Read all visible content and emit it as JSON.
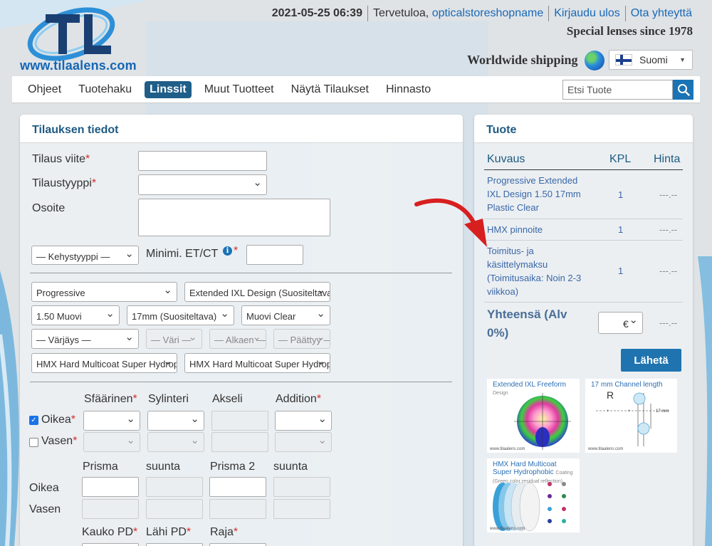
{
  "header": {
    "logo_text": "www.tilaalens.com",
    "datetime": "2021-05-25 06:39",
    "welcome_prefix": "Tervetuloa,",
    "username": "opticalstoreshopname",
    "logout": "Kirjaudu ulos",
    "contact": "Ota yhteyttä",
    "tagline": "Special lenses since 1978",
    "shipping": "Worldwide shipping",
    "language": "Suomi"
  },
  "nav": {
    "items": [
      "Ohjeet",
      "Tuotehaku",
      "Linssit",
      "Muut Tuotteet",
      "Näytä Tilaukset",
      "Hinnasto"
    ],
    "active_index": 2,
    "search_placeholder": "Etsi Tuote"
  },
  "order": {
    "title": "Tilauksen tiedot",
    "ref_label": "Tilaus viite",
    "type_label": "Tilaustyyppi",
    "address_label": "Osoite",
    "frame_type": "— Kehystyyppi —",
    "min_et_label": "Minimi. ET/CT",
    "lens_type": "Progressive",
    "design": "Extended IXL Design (Suositeltava)",
    "material": "1.50 Muovi",
    "corridor": "17mm (Suositeltava)",
    "clear": "Muovi Clear",
    "tint": "— Värjäys —",
    "color": "— Väri —",
    "start": "— Alkaen —",
    "end": "— Päättyy —",
    "coating1": "HMX Hard Multicoat Super Hydrophobic",
    "coating2": "HMX Hard Multicoat Super Hydrophobic",
    "col_sphere": "Sfäärinen",
    "col_cyl": "Sylinteri",
    "col_axis": "Akseli",
    "col_add": "Addition",
    "right_eye": "Oikea",
    "left_eye": "Vasen",
    "right_checked": true,
    "left_checked": false,
    "prism_label": "Prisma",
    "direction_label": "suunta",
    "prism2_label": "Prisma 2",
    "direction2_label": "suunta",
    "right_row": "Oikea",
    "left_row": "Vasen",
    "far_pd": "Kauko PD",
    "near_pd": "Lähi PD",
    "edge": "Raja"
  },
  "product": {
    "title": "Tuote",
    "col_desc": "Kuvaus",
    "col_qty": "KPL",
    "col_price": "Hinta",
    "rows": [
      {
        "desc": "Progressive Extended IXL Design 1.50 17mm Plastic Clear",
        "qty": "1",
        "price": "---.--"
      },
      {
        "desc": "HMX pinnoite",
        "qty": "1",
        "price": "---.--"
      },
      {
        "desc": "Toimitus- ja käsittelymaksu (Toimitusaika: Noin 2-3 viikkoa)",
        "qty": "1",
        "price": "---.--"
      }
    ],
    "total_label": "Yhteensä (Alv 0%)",
    "currency": "€",
    "total_price": "---.--",
    "send": "Lähetä",
    "thumb1_title": "Extended IXL Freeform",
    "thumb1_sub": "Design",
    "thumb2_title": "17 mm Channel length",
    "thumb2_r": "R",
    "thumb2_mm": "17 mm",
    "thumb3_title_1": "HMX Hard Multicoat",
    "thumb3_title_2": "Super Hydrophobic",
    "thumb3_coating": "Coating",
    "thumb3_sub": "(Green color residual reflection)",
    "thumb_site": "www.tilaalens.com"
  },
  "colors": {
    "brand_blue": "#1a69b7",
    "nav_active": "#1f5e89",
    "heading": "#1e5a82",
    "required": "#d32f2f",
    "button": "#1f74b0"
  }
}
